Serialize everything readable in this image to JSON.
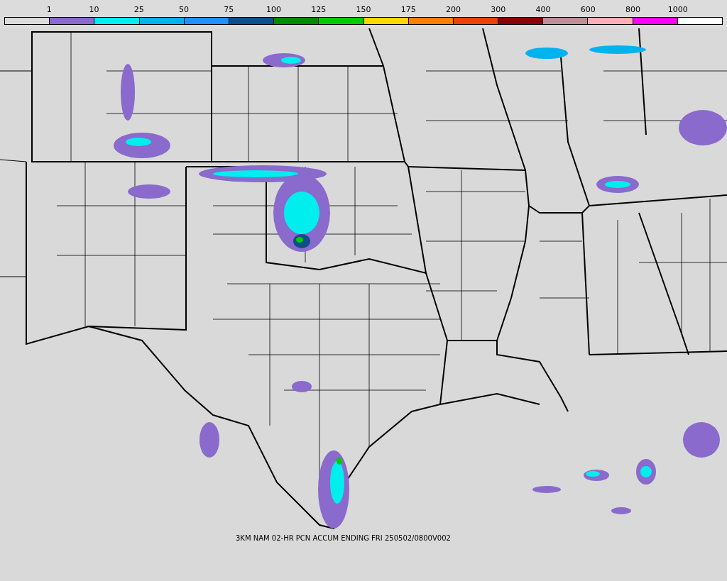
{
  "legend": {
    "bins": [
      {
        "color": "#dcdcdc",
        "label": "1"
      },
      {
        "color": "#8a6acc",
        "label": "10"
      },
      {
        "color": "#00eeee",
        "label": "25"
      },
      {
        "color": "#00b2ee",
        "label": "50"
      },
      {
        "color": "#1e90ff",
        "label": "75"
      },
      {
        "color": "#104e8b",
        "label": "100"
      },
      {
        "color": "#008b00",
        "label": "125"
      },
      {
        "color": "#00cd00",
        "label": "150"
      },
      {
        "color": "#ffd700",
        "label": "175"
      },
      {
        "color": "#ff7f00",
        "label": "200"
      },
      {
        "color": "#ee4000",
        "label": "300"
      },
      {
        "color": "#8b0000",
        "label": "400"
      },
      {
        "color": "#c08c98",
        "label": "600"
      },
      {
        "color": "#ffaeb9",
        "label": "800"
      },
      {
        "color": "#ff00ff",
        "label": "1000"
      },
      {
        "color": "#ffffff"
      }
    ]
  },
  "caption": "3KM NAM 02-HR PCN ACCUM ENDING FRI 250502/0800V002"
}
